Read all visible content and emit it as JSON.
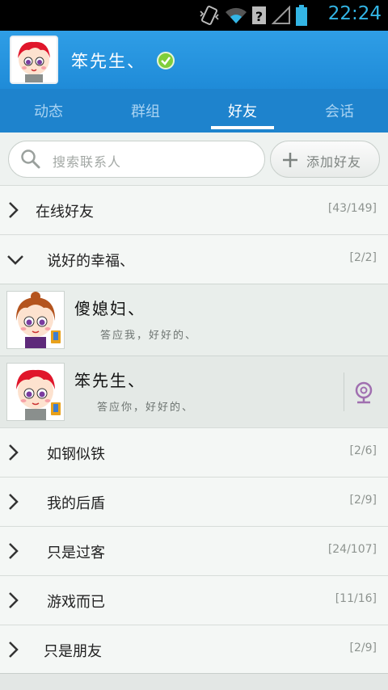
{
  "status_bar": {
    "time": "22:24"
  },
  "header": {
    "username": "笨先生、"
  },
  "tabs": [
    {
      "label": "动态"
    },
    {
      "label": "群组"
    },
    {
      "label": "好友"
    },
    {
      "label": "会话"
    }
  ],
  "search": {
    "placeholder": "搜索联系人",
    "add_label": "添加好友"
  },
  "groups": [
    {
      "name": "在线好友",
      "count": "[43/149]"
    },
    {
      "name": "说好的幸福、",
      "count": "[2/2]"
    },
    {
      "name": "如钢似铁",
      "count": "[2/6]"
    },
    {
      "name": "我的后盾",
      "count": "[2/9]"
    },
    {
      "name": "只是过客",
      "count": "[24/107]"
    },
    {
      "name": "游戏而已",
      "count": "[11/16]"
    },
    {
      "name": "只是朋友",
      "count": "[2/9]"
    }
  ],
  "friends": [
    {
      "name": "傻媳妇、",
      "signature": "答应我，好好的、"
    },
    {
      "name": "笨先生、",
      "signature": "答应你，好好的、"
    }
  ],
  "colors": {
    "header": "#2f9ee6",
    "tabbar": "#1e83cd",
    "clock": "#33b5e5",
    "verified": "#7fce3a"
  }
}
